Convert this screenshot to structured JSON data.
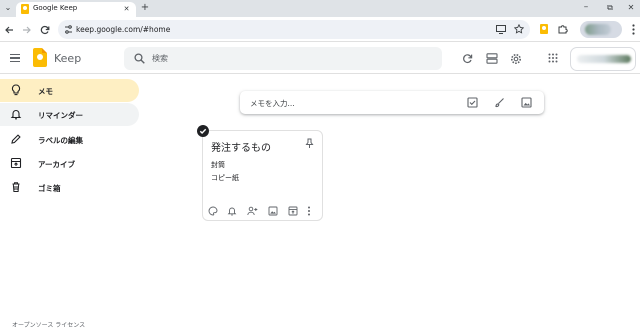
{
  "browser": {
    "tab_title": "Google Keep",
    "url": "keep.google.com/#home",
    "new_tab_symbol": "+",
    "tab_search_symbol": "⌄",
    "close_tab_symbol": "✕",
    "window_controls": {
      "minimize": "–",
      "restore": "⧉",
      "close": "✕"
    }
  },
  "header": {
    "app_name": "Keep",
    "search_placeholder": "検索"
  },
  "sidebar": {
    "items": [
      {
        "label": "メモ",
        "icon": "lightbulb-icon",
        "state": "active"
      },
      {
        "label": "リマインダー",
        "icon": "bell-icon",
        "state": "hover"
      },
      {
        "label": "ラベルの編集",
        "icon": "pencil-icon",
        "state": "normal"
      },
      {
        "label": "アーカイブ",
        "icon": "archive-icon",
        "state": "normal"
      },
      {
        "label": "ゴミ箱",
        "icon": "trash-icon",
        "state": "normal"
      }
    ]
  },
  "take_note": {
    "placeholder": "メモを入力..."
  },
  "note": {
    "title": "発注するもの",
    "lines": [
      "封筒",
      "コピー紙"
    ]
  },
  "footer": {
    "text": "オープンソース ライセンス"
  },
  "colors": {
    "active_nav": "#feefc3",
    "hover_nav": "#f1f3f4",
    "keep_yellow": "#fbbc04",
    "tabstrip": "#dfe3e7"
  }
}
